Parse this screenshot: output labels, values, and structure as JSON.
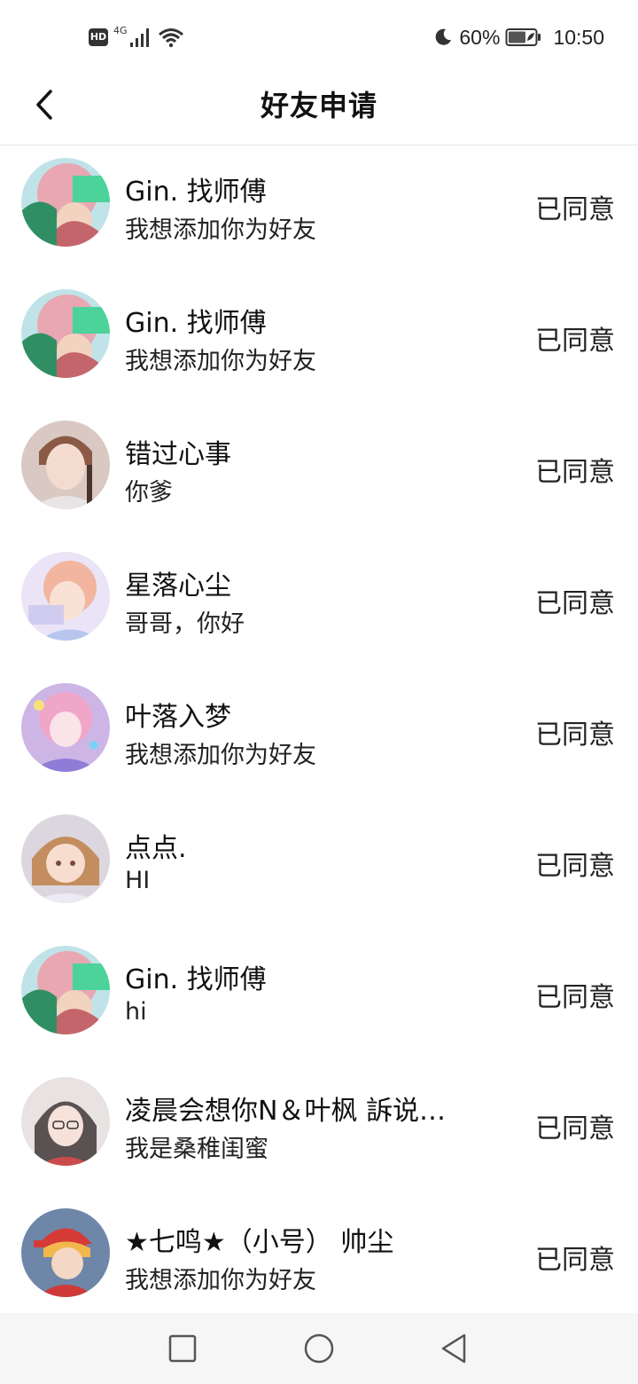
{
  "status_bar": {
    "hd": "HD",
    "network": "4G",
    "battery": "60%",
    "time": "10:50",
    "icons": [
      "hd-icon",
      "signal-icon",
      "wifi-icon",
      "moon-icon",
      "battery-icon"
    ]
  },
  "header": {
    "title": "好友申请",
    "back_icon": "chevron-left-icon"
  },
  "requests": [
    {
      "name": "Gin.  找师傅",
      "message": "我想添加你为好友",
      "status": "已同意",
      "avatar": "a"
    },
    {
      "name": "Gin.  找师傅",
      "message": "我想添加你为好友",
      "status": "已同意",
      "avatar": "a"
    },
    {
      "name": "错过心事",
      "message": "你爹",
      "status": "已同意",
      "avatar": "b"
    },
    {
      "name": "星落心尘",
      "message": "哥哥，你好",
      "status": "已同意",
      "avatar": "c"
    },
    {
      "name": "叶落入梦",
      "message": "我想添加你为好友",
      "status": "已同意",
      "avatar": "d"
    },
    {
      "name": "点点.",
      "message": "HI",
      "status": "已同意",
      "avatar": "e"
    },
    {
      "name": "Gin.  找师傅",
      "message": "hi",
      "status": "已同意",
      "avatar": "a"
    },
    {
      "name": "凌晨会想你N＆叶枫 訴说…",
      "message": "我是桑稚闺蜜",
      "status": "已同意",
      "avatar": "f"
    },
    {
      "name": "★七鸣★（小号）  帅尘",
      "message": "我想添加你为好友",
      "status": "已同意",
      "avatar": "g"
    }
  ],
  "nav_bar": {
    "icons": [
      "recent-apps-icon",
      "home-icon",
      "back-icon"
    ]
  }
}
